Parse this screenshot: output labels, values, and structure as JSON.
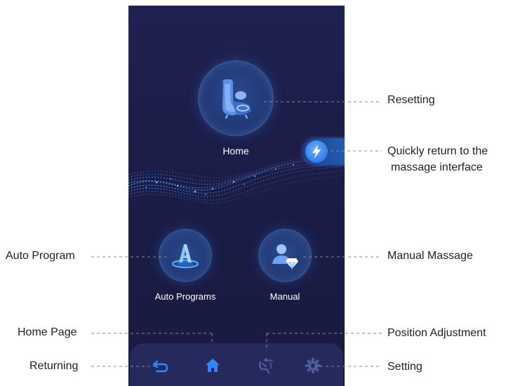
{
  "screen": {
    "home": {
      "label": "Home",
      "icon": "massage-chair-icon"
    },
    "quick_return": {
      "icon": "lightning-icon"
    },
    "auto_programs": {
      "label": "Auto Programs",
      "icon": "letter-a-icon"
    },
    "manual": {
      "label": "Manual",
      "icon": "user-diamond-icon"
    },
    "bottom_nav": [
      {
        "icon": "return-arrow-icon"
      },
      {
        "icon": "home-icon",
        "active": true
      },
      {
        "icon": "position-adjust-icon"
      },
      {
        "icon": "gear-icon"
      }
    ]
  },
  "callouts": {
    "resetting": "Resetting",
    "quick_return_line1": "Quickly return to the",
    "quick_return_line2": "massage interface",
    "auto_program": "Auto Program",
    "manual_massage": "Manual Massage",
    "home_page": "Home Page",
    "position_adjustment": "Position Adjustment",
    "returning": "Returning",
    "setting": "Setting"
  },
  "colors": {
    "background": "#1c1e48",
    "accent": "#2f86ff",
    "inactive_icon": "#4e5a9a"
  }
}
